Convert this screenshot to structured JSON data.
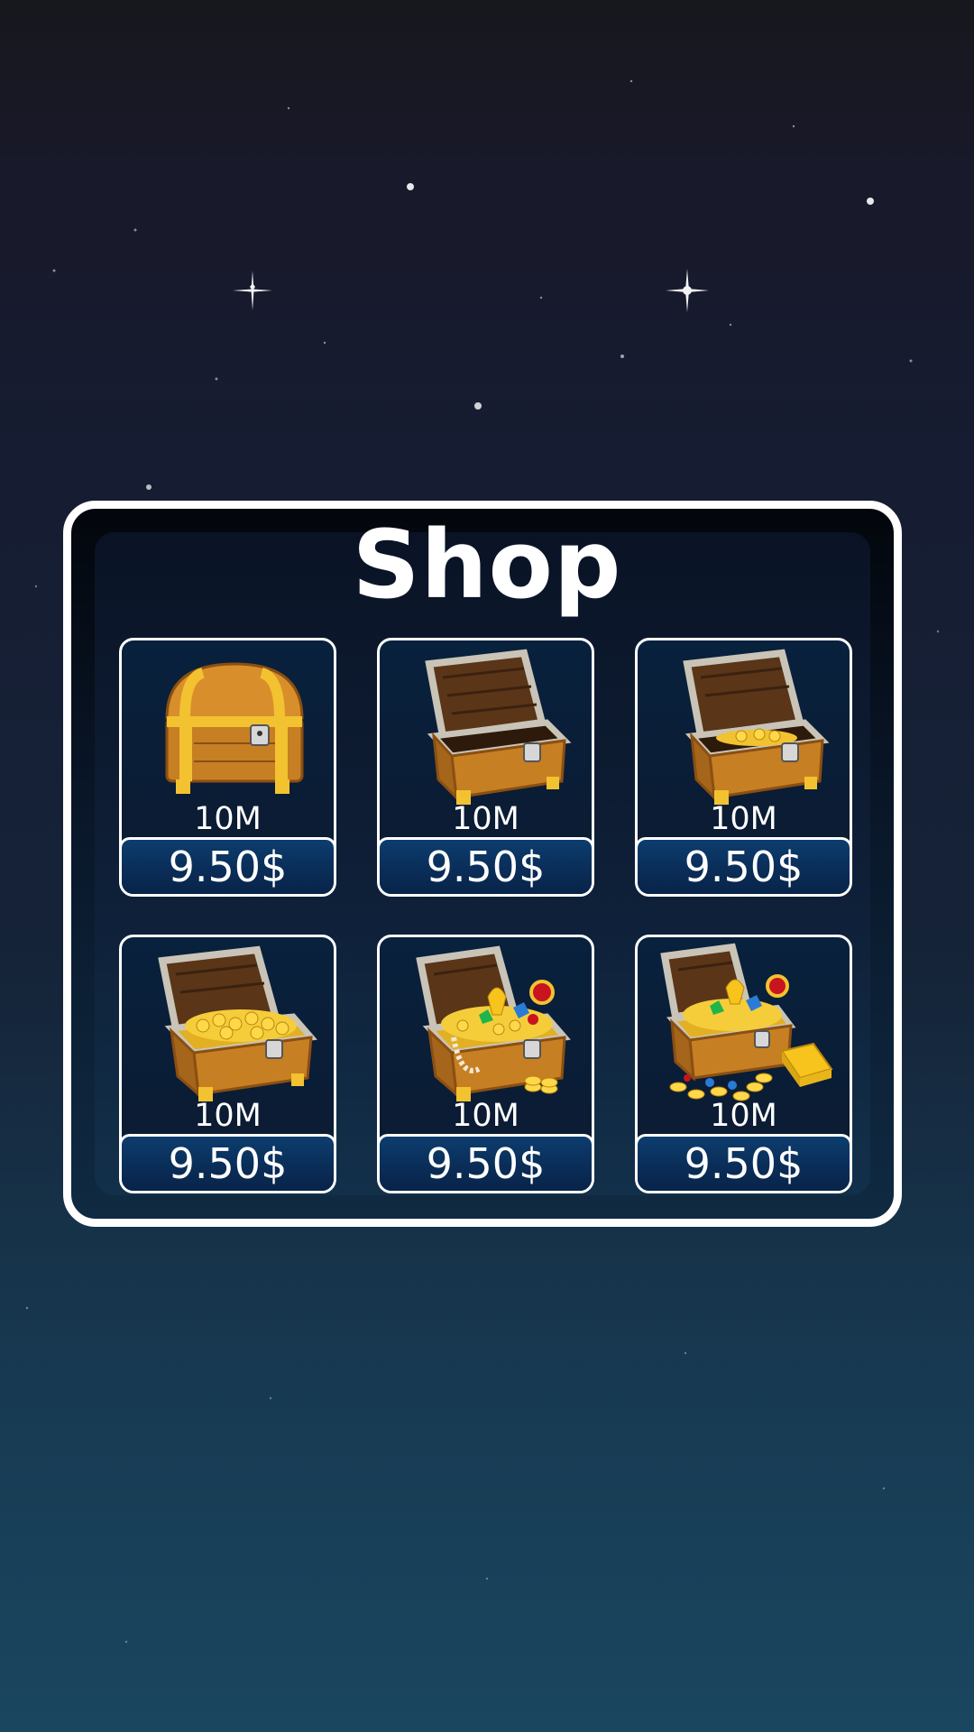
{
  "shop": {
    "title": "Shop",
    "items": [
      {
        "amount": "10M",
        "price": "9.50$",
        "icon": "closed-chest-icon"
      },
      {
        "amount": "10M",
        "price": "9.50$",
        "icon": "empty-open-chest-icon"
      },
      {
        "amount": "10M",
        "price": "9.50$",
        "icon": "chest-few-coins-icon"
      },
      {
        "amount": "10M",
        "price": "9.50$",
        "icon": "chest-full-coins-icon"
      },
      {
        "amount": "10M",
        "price": "9.50$",
        "icon": "chest-jewels-icon"
      },
      {
        "amount": "10M",
        "price": "9.50$",
        "icon": "chest-treasure-gold-bar-icon"
      }
    ]
  },
  "colors": {
    "panel_border": "#ffffff",
    "price_button": "#0a2c56",
    "chest_wood": "#c77f23",
    "gold": "#f2c230"
  }
}
